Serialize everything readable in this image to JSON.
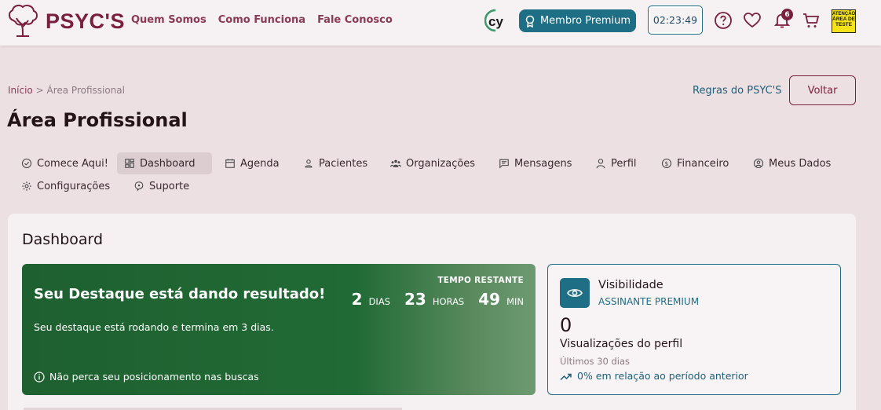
{
  "header": {
    "brand": "PSYC'S",
    "nav": [
      "Quem Somos",
      "Como Funciona",
      "Fale Conosco"
    ],
    "cy_logo_text": "cy",
    "premium_label": "Membro Premium",
    "timer": "02:23:49",
    "notification_count": "6",
    "test_badge": {
      "line1": "ATENÇÃO",
      "line2": "ÁREA DE TESTE"
    },
    "icons": [
      "help-icon",
      "heart-icon",
      "bell-icon",
      "cart-icon"
    ]
  },
  "breadcrumb": {
    "home": "Início",
    "separator": ">",
    "current": "Área Profissional"
  },
  "page_title": "Área Profissional",
  "actions": {
    "rules_link": "Regras do PSYC'S",
    "back_button": "Voltar"
  },
  "tabs": [
    {
      "label": "Comece Aqui!",
      "icon": "check-circle-icon",
      "active": false
    },
    {
      "label": "Dashboard",
      "icon": "dashboard-icon",
      "active": true
    },
    {
      "label": "Agenda",
      "icon": "calendar-icon",
      "active": false
    },
    {
      "label": "Pacientes",
      "icon": "user-icon",
      "active": false
    },
    {
      "label": "Organizações",
      "icon": "group-icon",
      "active": false
    },
    {
      "label": "Mensagens",
      "icon": "message-icon",
      "active": false
    },
    {
      "label": "Perfil",
      "icon": "person-icon",
      "active": false
    },
    {
      "label": "Financeiro",
      "icon": "dollar-icon",
      "active": false
    },
    {
      "label": "Meus Dados",
      "icon": "account-circle-icon",
      "active": false
    },
    {
      "label": "Configurações",
      "icon": "gear-icon",
      "active": false
    },
    {
      "label": "Suporte",
      "icon": "support-icon",
      "active": false
    }
  ],
  "dashboard": {
    "title": "Dashboard",
    "highlight": {
      "title": "Seu Destaque está dando resultado!",
      "description": "Seu destaque está rodando e termina em 3 dias.",
      "note": "Não perca seu posicionamento nas buscas",
      "remaining_label": "TEMPO RESTANTE",
      "countdown": {
        "days": "2",
        "days_unit": "DIAS",
        "hours": "23",
        "hours_unit": "HORAS",
        "minutes": "49",
        "minutes_unit": "MIN"
      }
    },
    "visibility": {
      "title": "Visibilidade",
      "subtitle": "ASSINANTE PREMIUM",
      "count": "0",
      "label": "Visualizações do perfil",
      "period": "Últimos 30 dias",
      "trend": "0% em relação ao período anterior"
    }
  },
  "colors": {
    "brand": "#7a1f3d",
    "accent": "#1e6e85",
    "highlight_green": "#206a35",
    "background": "#ece0e3"
  }
}
